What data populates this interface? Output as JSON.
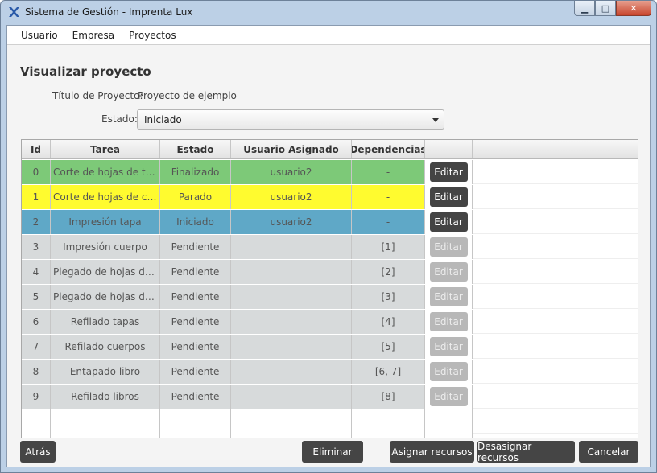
{
  "window": {
    "title": "Sistema de Gestión - Imprenta Lux",
    "app_icon": "x-logo-icon",
    "controls": {
      "minimize": "▁",
      "maximize": "□",
      "close": "✕"
    }
  },
  "menu": [
    "Usuario",
    "Empresa",
    "Proyectos"
  ],
  "page": {
    "title": "Visualizar proyecto",
    "project_title_label": "Título de Proyecto:",
    "project_title_value": "Proyecto de ejemplo",
    "status_label": "Estado:",
    "status_value": "Iniciado"
  },
  "table": {
    "headers": [
      "Id",
      "Tarea",
      "Estado",
      "Usuario Asignado",
      "Dependencias",
      ""
    ],
    "rows": [
      {
        "id": "0",
        "task": "Corte de hojas de tapa",
        "status": "Finalizado",
        "user": "usuario2",
        "deps": "-",
        "action": "Editar",
        "enabled": true
      },
      {
        "id": "1",
        "task": "Corte de hojas de cuer...",
        "status": "Parado",
        "user": "usuario2",
        "deps": "-",
        "action": "Editar",
        "enabled": true
      },
      {
        "id": "2",
        "task": "Impresión tapa",
        "status": "Iniciado",
        "user": "usuario2",
        "deps": "-",
        "action": "Editar",
        "enabled": true
      },
      {
        "id": "3",
        "task": "Impresión cuerpo",
        "status": "Pendiente",
        "user": "",
        "deps": "[1]",
        "action": "Editar",
        "enabled": false
      },
      {
        "id": "4",
        "task": "Plegado de hojas de t...",
        "status": "Pendiente",
        "user": "",
        "deps": "[2]",
        "action": "Editar",
        "enabled": false
      },
      {
        "id": "5",
        "task": "Plegado de hojas de c...",
        "status": "Pendiente",
        "user": "",
        "deps": "[3]",
        "action": "Editar",
        "enabled": false
      },
      {
        "id": "6",
        "task": "Refilado tapas",
        "status": "Pendiente",
        "user": "",
        "deps": "[4]",
        "action": "Editar",
        "enabled": false
      },
      {
        "id": "7",
        "task": "Refilado cuerpos",
        "status": "Pendiente",
        "user": "",
        "deps": "[5]",
        "action": "Editar",
        "enabled": false
      },
      {
        "id": "8",
        "task": "Entapado libro",
        "status": "Pendiente",
        "user": "",
        "deps": "[6, 7]",
        "action": "Editar",
        "enabled": false
      },
      {
        "id": "9",
        "task": "Refilado libros",
        "status": "Pendiente",
        "user": "",
        "deps": "[8]",
        "action": "Editar",
        "enabled": false
      }
    ],
    "row_colors": {
      "Finalizado": "#7dc978",
      "Parado": "#fffb2f",
      "Iniciado": "#5fa8c7",
      "Pendiente": "#d7dadb"
    }
  },
  "buttons": {
    "back": "Atrás",
    "delete": "Eliminar",
    "assign": "Asignar recursos",
    "unassign": "Desasignar recursos",
    "cancel": "Cancelar"
  }
}
